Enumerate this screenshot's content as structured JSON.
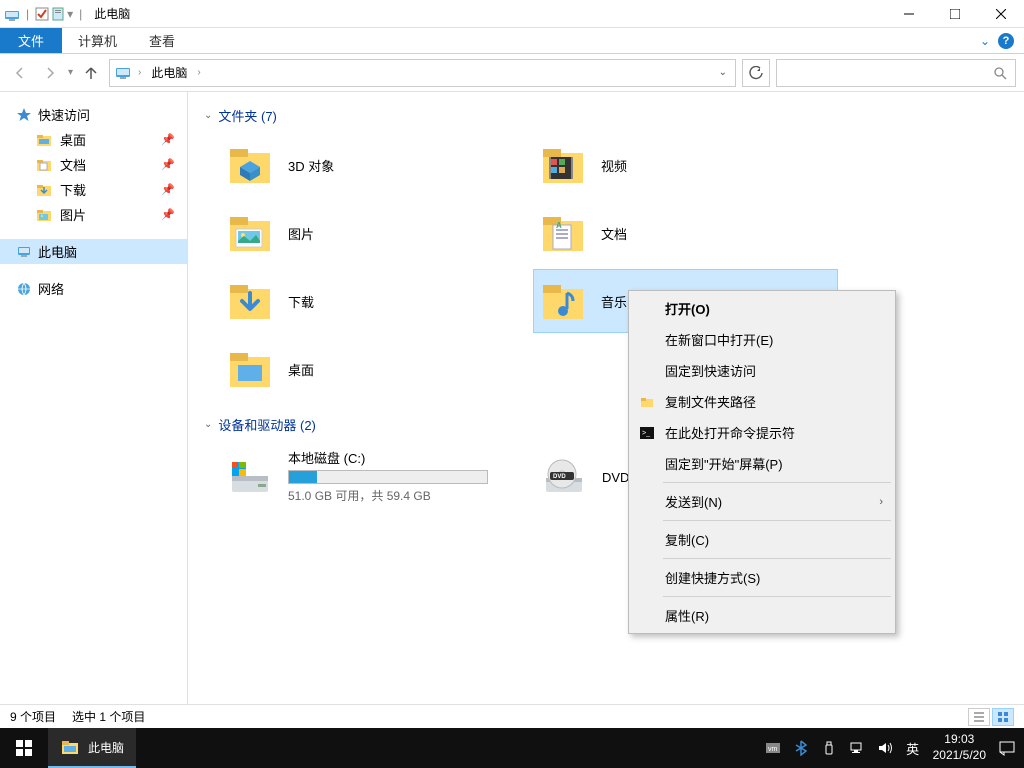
{
  "title": "此电脑",
  "ribbon": {
    "file": "文件",
    "tab1": "计算机",
    "tab2": "查看"
  },
  "breadcrumb": {
    "root": "此电脑"
  },
  "sidebar": {
    "quickaccess": {
      "label": "快速访问",
      "items": [
        {
          "label": "桌面"
        },
        {
          "label": "文档"
        },
        {
          "label": "下载"
        },
        {
          "label": "图片"
        }
      ]
    },
    "thispc": {
      "label": "此电脑"
    },
    "network": {
      "label": "网络"
    }
  },
  "sections": {
    "folders": {
      "title": "文件夹 (7)"
    },
    "devices": {
      "title": "设备和驱动器 (2)"
    }
  },
  "folders": {
    "obj3d": "3D 对象",
    "video": "视频",
    "pictures": "图片",
    "documents": "文档",
    "downloads": "下载",
    "music": "音乐",
    "desktop": "桌面"
  },
  "drives": {
    "local": {
      "name": "本地磁盘 (C:)",
      "freetext": "51.0 GB 可用，共 59.4 GB",
      "fill_pct": 14
    },
    "dvd": {
      "name": "DVD 驱"
    }
  },
  "contextmenu": {
    "open": "打开(O)",
    "newwin": "在新窗口中打开(E)",
    "pinqa": "固定到快速访问",
    "copypath": "复制文件夹路径",
    "cmdhere": "在此处打开命令提示符",
    "pinstart": "固定到\"开始\"屏幕(P)",
    "sendto": "发送到(N)",
    "copy": "复制(C)",
    "shortcut": "创建快捷方式(S)",
    "props": "属性(R)"
  },
  "statusbar": {
    "count": "9 个项目",
    "selected": "选中 1 个项目"
  },
  "taskbar": {
    "active": "此电脑",
    "ime": "英",
    "time": "19:03",
    "date": "2021/5/20"
  }
}
